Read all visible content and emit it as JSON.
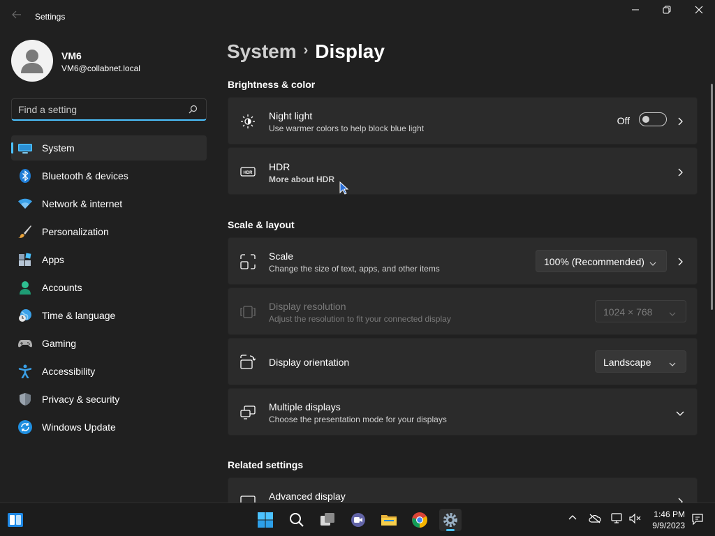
{
  "app": {
    "title": "Settings"
  },
  "user": {
    "name": "VM6",
    "email": "VM6@collabnet.local"
  },
  "search": {
    "placeholder": "Find a setting"
  },
  "nav": [
    {
      "label": "System",
      "icon": "system-icon",
      "active": true
    },
    {
      "label": "Bluetooth & devices",
      "icon": "bluetooth-icon"
    },
    {
      "label": "Network & internet",
      "icon": "wifi-icon"
    },
    {
      "label": "Personalization",
      "icon": "brush-icon"
    },
    {
      "label": "Apps",
      "icon": "apps-icon"
    },
    {
      "label": "Accounts",
      "icon": "accounts-icon"
    },
    {
      "label": "Time & language",
      "icon": "globe-clock-icon"
    },
    {
      "label": "Gaming",
      "icon": "controller-icon"
    },
    {
      "label": "Accessibility",
      "icon": "accessibility-icon"
    },
    {
      "label": "Privacy & security",
      "icon": "shield-icon"
    },
    {
      "label": "Windows Update",
      "icon": "update-icon"
    }
  ],
  "breadcrumb": {
    "parent": "System",
    "current": "Display"
  },
  "sections": {
    "brightness": "Brightness & color",
    "scale_layout": "Scale & layout",
    "related": "Related settings"
  },
  "night_light": {
    "title": "Night light",
    "subtitle": "Use warmer colors to help block blue light",
    "state": "Off"
  },
  "hdr": {
    "title": "HDR",
    "link": "More about HDR"
  },
  "scale": {
    "title": "Scale",
    "subtitle": "Change the size of text, apps, and other items",
    "value": "100% (Recommended)"
  },
  "resolution": {
    "title": "Display resolution",
    "subtitle": "Adjust the resolution to fit your connected display",
    "value": "1024 × 768"
  },
  "orientation": {
    "title": "Display orientation",
    "value": "Landscape"
  },
  "multiple": {
    "title": "Multiple displays",
    "subtitle": "Choose the presentation mode for your displays"
  },
  "advanced": {
    "title": "Advanced display"
  },
  "taskbar": {
    "time": "1:46 PM",
    "date": "9/9/2023"
  },
  "colors": {
    "accent": "#4cc2ff",
    "background": "#202020",
    "card": "#2b2b2b",
    "link": "#99ebff"
  }
}
